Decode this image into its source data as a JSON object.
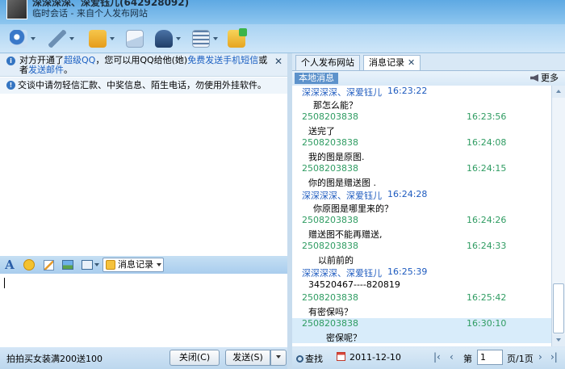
{
  "title": {
    "contact": "深深深深、深爱钰儿(642928092)",
    "subtitle": "临时会话 - 来自个人发布网站"
  },
  "toolbar": {
    "icons": [
      "video-icon",
      "voice-icon",
      "file-transfer-icon",
      "mail-icon",
      "remote-assist-icon",
      "block-icon",
      "app-icon"
    ]
  },
  "notices": {
    "line1_part1": "对方开通了",
    "line1_link1": "超级QQ",
    "line1_part2": "，您可以用QQ给他(她)",
    "line1_link2": "免费发送手机短信",
    "line1_part3": "或",
    "line1_part4": "者",
    "line1_link3": "发送邮件",
    "line1_part5": "。",
    "line2": "交谈中请勿轻信汇款、中奖信息、陌生电话，勿使用外挂软件。"
  },
  "input_toolbar": {
    "msg_record_label": "消息记录"
  },
  "bottom_left": {
    "ad_text": "拍拍买女装满200送100",
    "close_label": "关闭(C)",
    "send_label": "发送(S)"
  },
  "tabs": [
    {
      "label": "个人发布网站"
    },
    {
      "label": "消息记录"
    }
  ],
  "history_header": {
    "local_label": "本地消息",
    "more_label": "更多"
  },
  "messages": [
    {
      "sender": "深深深深、深爱钰儿",
      "time": "16:23:22",
      "text": "那怎么能？",
      "indent": 26,
      "self": true
    },
    {
      "sender": "2508203838",
      "time": "16:23:56",
      "text": "送完了",
      "indent": 20,
      "self": false
    },
    {
      "sender": "2508203838",
      "time": "16:24:08",
      "text": "我的图是原图.",
      "indent": 20,
      "self": false
    },
    {
      "sender": "2508203838",
      "time": "16:24:15",
      "text": "你的图是赠送图 .",
      "indent": 20,
      "self": false
    },
    {
      "sender": "深深深深、深爱钰儿",
      "time": "16:24:28",
      "text": "你原图是哪里来的？",
      "indent": 26,
      "self": true
    },
    {
      "sender": "2508203838",
      "time": "16:24:26",
      "text": "赠送图不能再赠送,",
      "indent": 20,
      "self": false
    },
    {
      "sender": "2508203838",
      "time": "16:24:33",
      "text": "以前前的",
      "indent": 32,
      "self": false
    },
    {
      "sender": "深深深深、深爱钰儿",
      "time": "16:25:39",
      "text": "34520467----820819",
      "indent": 20,
      "self": true
    },
    {
      "sender": "2508203838",
      "time": "16:25:42",
      "text": "有密保吗？",
      "indent": 20,
      "self": false
    },
    {
      "sender": "2508203838",
      "time": "16:30:10",
      "text": "密保呢？",
      "indent": 42,
      "self": false
    }
  ],
  "right_bottom": {
    "search_label": "查找",
    "date": "2011-12-10",
    "page_prefix": "第",
    "page_value": "1",
    "page_suffix": "页/1页"
  },
  "colors": {
    "self_sender": "#1e5bbf",
    "other_sender": "#2f9c62",
    "link": "#1a5fc2"
  }
}
